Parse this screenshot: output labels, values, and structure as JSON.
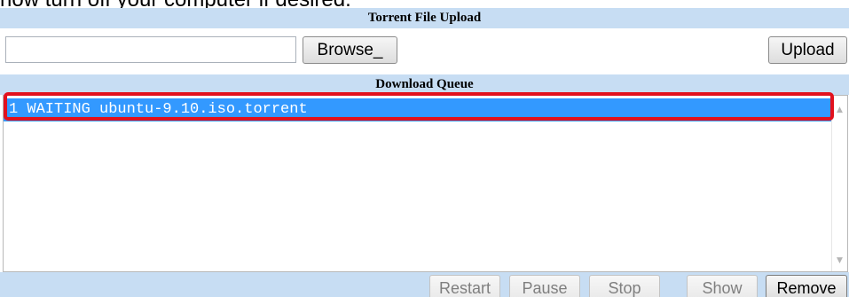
{
  "intro": {
    "text": "now turn off your computer if desired."
  },
  "upload_section": {
    "title": "Torrent File Upload",
    "file_value": "",
    "browse_label": "Browse_",
    "upload_label": "Upload"
  },
  "queue_section": {
    "title": "Download Queue",
    "items": [
      {
        "text": "1 WAITING ubuntu-9.10.iso.torrent",
        "selected": true
      }
    ],
    "scroll_up_icon": "▲",
    "scroll_down_icon": "▼"
  },
  "actions": {
    "restart_label": "Restart",
    "pause_label": "Pause",
    "stop_label": "Stop",
    "show_label": "Show",
    "remove_label": "Remove"
  },
  "colors": {
    "header_bg": "#c7ddf3",
    "selection_bg": "#3399ff",
    "highlight_border": "#e2111d",
    "disabled_text": "#7f7f7f"
  }
}
